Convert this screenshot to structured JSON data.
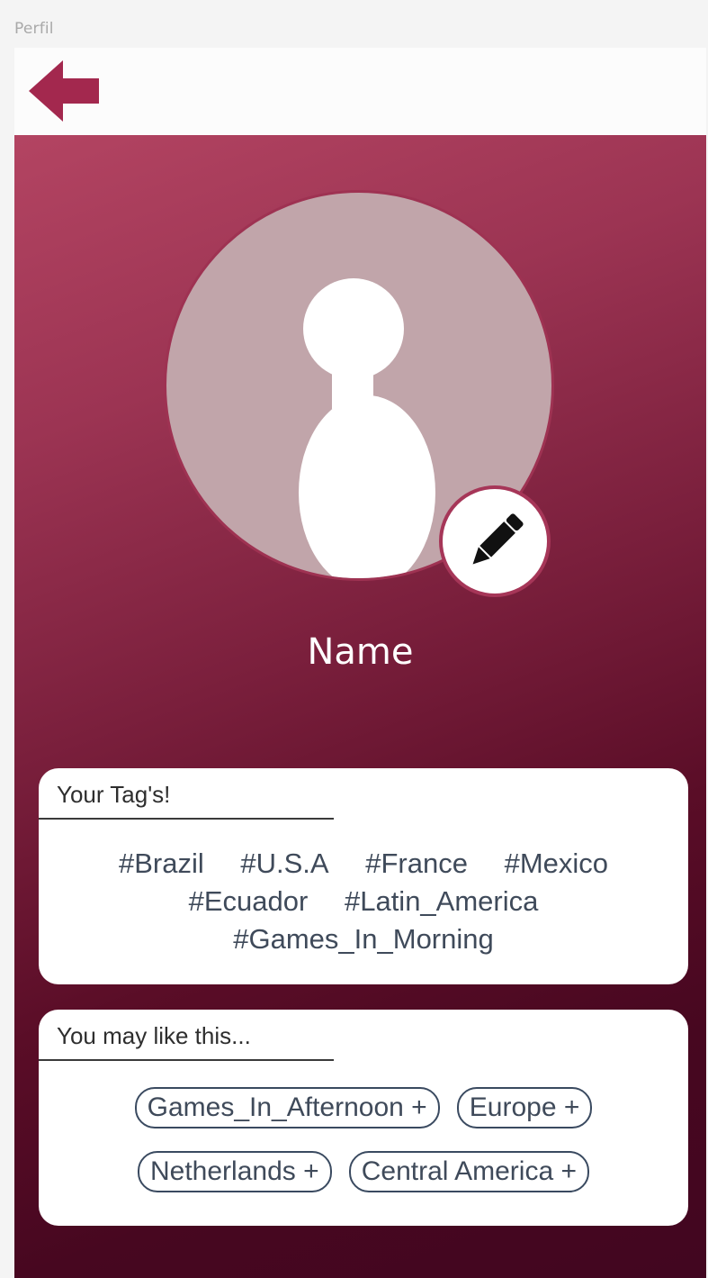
{
  "frame": {
    "label": "Perfil"
  },
  "header": {
    "back_icon": "arrow-left-icon",
    "accent_color": "#a3284e"
  },
  "profile": {
    "name": "Name",
    "avatar_icon": "person-silhouette-icon",
    "edit_icon": "pencil-icon"
  },
  "tags_card": {
    "title": "Your Tag's!",
    "rows": [
      [
        "#Brazil",
        "#U.S.A",
        "#France",
        "#Mexico"
      ],
      [
        "#Ecuador",
        "#Latin_America"
      ],
      [
        "#Games_In_Morning"
      ]
    ]
  },
  "suggestions_card": {
    "title": "You may like this...",
    "rows": [
      [
        "Games_In_Afternoon +",
        "Europe +"
      ],
      [
        "Netherlands +",
        "Central America +"
      ]
    ]
  },
  "colors": {
    "gradient_top": "#b34462",
    "gradient_bottom": "#420620",
    "avatar_bg": "#c1a5aa",
    "text_tags": "#3f4a5a"
  }
}
